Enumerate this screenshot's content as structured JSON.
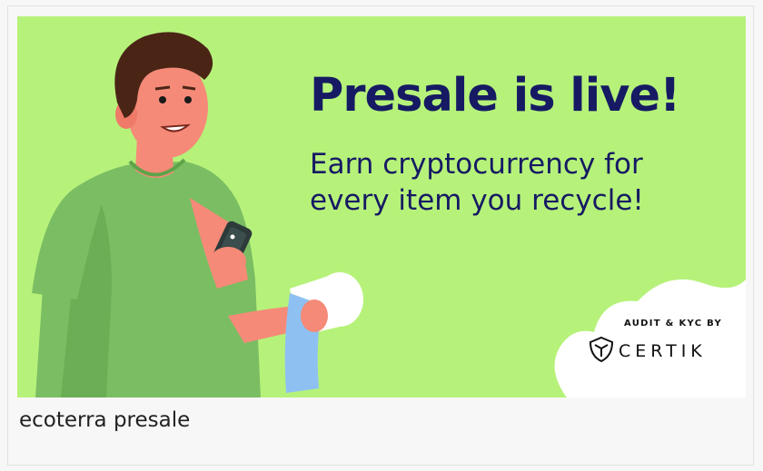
{
  "banner": {
    "headline": "Presale is live!",
    "subline_lines": [
      "Earn cryptocurrency for",
      "every item you recycle!"
    ],
    "badge": {
      "label": "AUDIT & KYC BY",
      "brand": "CERTIK",
      "icon": "certik-shield-icon"
    },
    "illustration": "person-holding-phone-and-receipt",
    "colors": {
      "background": "#b6f27a",
      "headline": "#161a63",
      "shirt": "#7bbd63",
      "skin": "#f58a78",
      "hair": "#4a2516",
      "receipt": "#8ec1f2",
      "badge_bg": "#ffffff"
    }
  },
  "caption": "ecoterra presale"
}
